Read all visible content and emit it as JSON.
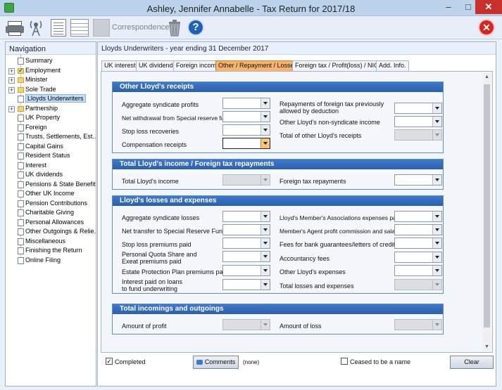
{
  "window": {
    "title": "Ashley, Jennifer Annabelle - Tax Return for 2017/18",
    "min": "–",
    "max": "□",
    "close": "✕"
  },
  "toolbar": {
    "correspondence_label": "Correspondence",
    "help": "?",
    "exit": "✕"
  },
  "nav": {
    "header": "Navigation",
    "items": [
      {
        "label": "Summary",
        "expand": "",
        "icon": "page"
      },
      {
        "label": "Employment",
        "expand": "+",
        "icon": "check"
      },
      {
        "label": "Minister",
        "expand": "+",
        "icon": "folder"
      },
      {
        "label": "Sole Trade",
        "expand": "+",
        "icon": "folder"
      },
      {
        "label": "Lloyds Underwriters",
        "expand": "",
        "icon": "page",
        "selected": true
      },
      {
        "label": "Partnership",
        "expand": "+",
        "icon": "folder"
      },
      {
        "label": "UK Property",
        "expand": "",
        "icon": "page"
      },
      {
        "label": "Foreign",
        "expand": "",
        "icon": "page"
      },
      {
        "label": "Trusts, Settlements, Est...",
        "expand": "",
        "icon": "page"
      },
      {
        "label": "Capital Gains",
        "expand": "",
        "icon": "page"
      },
      {
        "label": "Resident Status",
        "expand": "",
        "icon": "page"
      },
      {
        "label": "Interest",
        "expand": "",
        "icon": "page"
      },
      {
        "label": "UK dividends",
        "expand": "",
        "icon": "page"
      },
      {
        "label": "Pensions & State Benefits",
        "expand": "",
        "icon": "page"
      },
      {
        "label": "Other UK Income",
        "expand": "",
        "icon": "page"
      },
      {
        "label": "Pension Contributions",
        "expand": "",
        "icon": "page"
      },
      {
        "label": "Charitable Giving",
        "expand": "",
        "icon": "page"
      },
      {
        "label": "Personal Allowances",
        "expand": "",
        "icon": "page"
      },
      {
        "label": "Other Outgoings & Relie...",
        "expand": "",
        "icon": "page"
      },
      {
        "label": "Miscellaneous",
        "expand": "",
        "icon": "page"
      },
      {
        "label": "Finishing the Return",
        "expand": "",
        "icon": "page"
      },
      {
        "label": "Online Filing",
        "expand": "",
        "icon": "page"
      }
    ]
  },
  "main": {
    "header": "Lloyds Underwriters - year ending 31 December 2017",
    "tabs": [
      {
        "label": "UK interest"
      },
      {
        "label": "UK dividends"
      },
      {
        "label": "Foreign income"
      },
      {
        "label": "Other / Repayment / Losses",
        "active": true
      },
      {
        "label": "Foreign tax / Profit(loss) / NICs"
      },
      {
        "label": "Add. Info."
      }
    ]
  },
  "sections": {
    "receipts": {
      "title": "Other Lloyd's receipts",
      "left": [
        "Aggregate syndicate profits",
        "Net withdrawal from Special reserve fund",
        "Stop loss recoveries",
        "Compensation receipts"
      ],
      "right": [
        "Repayments of foreign tax previously allowed by deduction",
        "Other Lloyd's non-syndicate income",
        "Total of other Lloyd's receipts"
      ]
    },
    "income": {
      "title": "Total Lloyd's income / Foreign tax repayments",
      "left": [
        "Total Lloyd's income"
      ],
      "right": [
        "Foreign tax repayments"
      ]
    },
    "losses": {
      "title": "Lloyd's losses and expenses",
      "left": [
        "Aggregate syndicate losses",
        "Net transfer to Special Reserve Fund",
        "Stop loss premiums paid",
        "Personal Quota Share and Exeat premiums paid",
        "Estate Protection Plan premiums paid",
        "Interest paid on loans to fund underwriting"
      ],
      "right": [
        "Lloyd's Member's Associations expenses paid",
        "Member's Agent profit commission and salaries",
        "Fees for bank guarantees/letters of credit",
        "Accountancy fees",
        "Other Lloyd's expenses",
        "Total losses and expenses"
      ]
    },
    "totals": {
      "title": "Total incomings and outgoings",
      "left": [
        "Amount of profit"
      ],
      "right": [
        "Amount of loss"
      ]
    }
  },
  "bottom": {
    "completed_label": "Completed",
    "completed_checked": "✓",
    "comments_label": "Comments",
    "comments_value": "(none)",
    "ceased_label": "Ceased to be a name",
    "clear_label": "Clear"
  }
}
